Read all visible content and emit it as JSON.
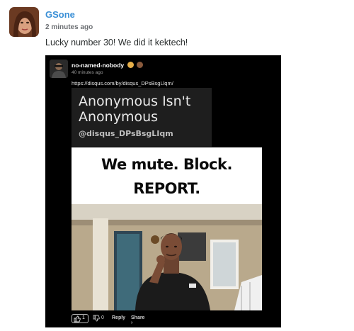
{
  "comment": {
    "author": "GSone",
    "time": "2 minutes ago",
    "message": "Lucky number 30! We did it kektech!"
  },
  "embed": {
    "author": "no-named-nobody",
    "time": "40 minutes ago",
    "link": "https://disqus.com/by/disqus_DPsBsgLlqm/",
    "card": {
      "title": "Anonymous Isn't Anonymous",
      "handle": "@disqus_DPsBsgLIqm"
    },
    "gif": {
      "line1": "We mute. Block.",
      "line2": "REPORT."
    },
    "footer": {
      "upvotes": "1",
      "downvotes": "0",
      "reply": "Reply",
      "share": "Share ›"
    }
  },
  "colors": {
    "author_link": "#3a8fd6",
    "embed_background": "#000000"
  },
  "icons": [
    "thumbs-up-icon",
    "thumbs-down-icon",
    "emoji-icon"
  ]
}
